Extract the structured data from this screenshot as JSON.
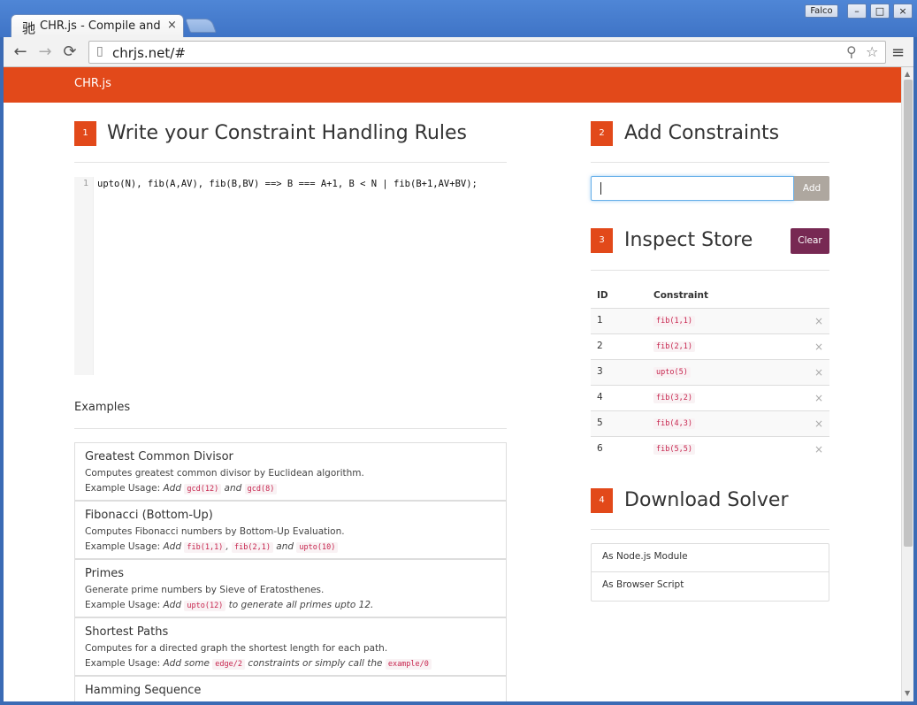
{
  "browser": {
    "tab_favicon": "驰",
    "tab_title": "CHR.js - Compile and",
    "tab_close": "×",
    "user": "Falco",
    "window_min": "–",
    "window_max": "□",
    "window_close": "×",
    "back": "←",
    "forward": "→",
    "reload": "⟳",
    "url": "chrjs.net/#",
    "menu": "≡"
  },
  "navbar": {
    "brand": "CHR.js"
  },
  "rules": {
    "step": "1",
    "title": "Write your Constraint Handling Rules",
    "line_number": "1",
    "code": "upto(N), fib(A,AV), fib(B,BV) ==> B === A+1, B < N | fib(B+1,AV+BV);"
  },
  "examples": {
    "label": "Examples",
    "items": [
      {
        "title": "Greatest Common Divisor",
        "description": "Computes greatest common divisor by Euclidean algorithm.",
        "usage_prefix": "Example Usage:",
        "usage_add": "Add",
        "code1": "gcd(12)",
        "mid1": "and",
        "code2": "gcd(8)"
      },
      {
        "title": "Fibonacci (Bottom-Up)",
        "description": "Computes Fibonacci numbers by Bottom-Up Evaluation.",
        "usage_prefix": "Example Usage:",
        "usage_add": "Add",
        "code1": "fib(1,1)",
        "mid1": ",",
        "code2": "fib(2,1)",
        "mid2": "and",
        "code3": "upto(10)"
      },
      {
        "title": "Primes",
        "description": "Generate prime numbers by Sieve of Eratosthenes.",
        "usage_prefix": "Example Usage:",
        "usage_add": "Add",
        "code1": "upto(12)",
        "suffix": "to generate all primes upto 12."
      },
      {
        "title": "Shortest Paths",
        "description": "Computes for a directed graph the shortest length for each path.",
        "usage_prefix": "Example Usage:",
        "usage_add": "Add some",
        "code1": "edge/2",
        "mid1": "constraints or simply call the",
        "code2": "example/0"
      },
      {
        "title": "Hamming Sequence"
      }
    ]
  },
  "constraints": {
    "step": "2",
    "title": "Add Constraints",
    "input_value": "",
    "add_label": "Add"
  },
  "store": {
    "step": "3",
    "title": "Inspect Store",
    "clear_label": "Clear",
    "col_id": "ID",
    "col_constraint": "Constraint",
    "remove": "×",
    "rows": [
      {
        "id": "1",
        "constraint": "fib(1,1)"
      },
      {
        "id": "2",
        "constraint": "fib(2,1)"
      },
      {
        "id": "3",
        "constraint": "upto(5)"
      },
      {
        "id": "4",
        "constraint": "fib(3,2)"
      },
      {
        "id": "5",
        "constraint": "fib(4,3)"
      },
      {
        "id": "6",
        "constraint": "fib(5,5)"
      }
    ]
  },
  "download": {
    "step": "4",
    "title": "Download Solver",
    "items": [
      "As Node.js Module",
      "As Browser Script"
    ]
  },
  "colors": {
    "brand_orange": "#e2491a",
    "clear_purple": "#772953",
    "add_gray": "#aea79f"
  }
}
